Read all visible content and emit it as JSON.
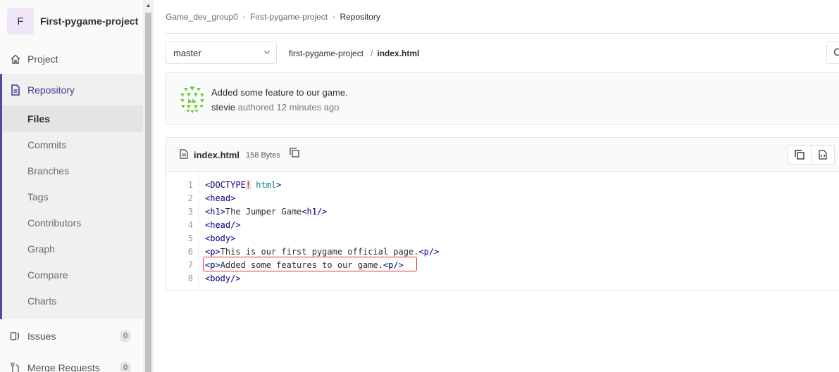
{
  "project": {
    "avatar_letter": "F",
    "name": "First-pygame-project"
  },
  "sidebar": {
    "project_label": "Project",
    "repository_label": "Repository",
    "sub_items": [
      {
        "label": "Files",
        "active": true
      },
      {
        "label": "Commits"
      },
      {
        "label": "Branches"
      },
      {
        "label": "Tags"
      },
      {
        "label": "Contributors"
      },
      {
        "label": "Graph"
      },
      {
        "label": "Compare"
      },
      {
        "label": "Charts"
      }
    ],
    "issues_label": "Issues",
    "issues_count": "0",
    "merge_requests_label": "Merge Requests",
    "merge_requests_count": "0"
  },
  "breadcrumb": {
    "group": "Game_dev_group0",
    "project": "First-pygame-project",
    "current": "Repository"
  },
  "branch_selector": {
    "value": "master"
  },
  "path": {
    "root": "first-pygame-project",
    "separator": "/",
    "file": "index.html"
  },
  "last_commit": {
    "title": "Added some feature to our game.",
    "author": "stevie",
    "action": "authored",
    "time": "12 minutes ago"
  },
  "file": {
    "name": "index.html",
    "size": "158 Bytes",
    "lines": [
      {
        "num": "1",
        "parts": [
          {
            "t": "tag",
            "v": "<DOCTYPE"
          },
          {
            "t": "err",
            "v": "!"
          },
          {
            "t": "txt",
            "v": " "
          },
          {
            "t": "attr",
            "v": "html"
          },
          {
            "t": "tag",
            "v": ">"
          }
        ]
      },
      {
        "num": "2",
        "parts": [
          {
            "t": "tag",
            "v": "<head>"
          }
        ]
      },
      {
        "num": "3",
        "parts": [
          {
            "t": "tag",
            "v": "<h1>"
          },
          {
            "t": "txt",
            "v": "The Jumper Game"
          },
          {
            "t": "tag",
            "v": "<h1/>"
          }
        ]
      },
      {
        "num": "4",
        "parts": [
          {
            "t": "tag",
            "v": "<head/>"
          }
        ]
      },
      {
        "num": "5",
        "parts": [
          {
            "t": "tag",
            "v": "<body>"
          }
        ]
      },
      {
        "num": "6",
        "parts": [
          {
            "t": "tag",
            "v": "<p>"
          },
          {
            "t": "txt",
            "v": "This is our first pygame official page."
          },
          {
            "t": "tag",
            "v": "<p/>"
          }
        ]
      },
      {
        "num": "7",
        "parts": [
          {
            "t": "tag",
            "v": "<p>"
          },
          {
            "t": "txt",
            "v": "Added some features to our game."
          },
          {
            "t": "tag",
            "v": "<p/>"
          }
        ]
      },
      {
        "num": "8",
        "parts": [
          {
            "t": "tag",
            "v": "<body/>"
          }
        ]
      }
    ]
  },
  "colors": {
    "accent": "#4b4ba3",
    "highlight_border": "#e0302e"
  }
}
